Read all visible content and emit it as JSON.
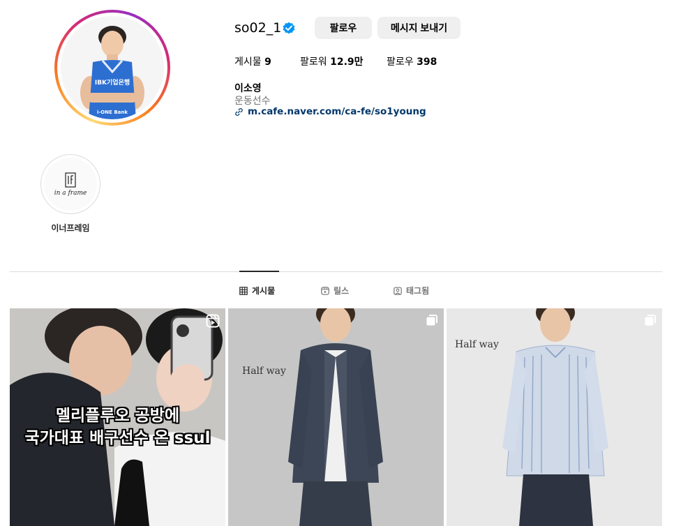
{
  "profile": {
    "username": "so02_1",
    "follow_label": "팔로우",
    "message_label": "메시지 보내기",
    "stats": {
      "posts_label": "게시물",
      "posts_value": "9",
      "followers_label": "팔로워",
      "followers_value": "12.9만",
      "following_label": "팔로우",
      "following_value": "398"
    },
    "full_name": "이소영",
    "category": "운동선수",
    "link": "m.cafe.naver.com/ca-fe/so1young",
    "avatar_jersey_text": "IBK기업은행",
    "avatar_jersey_text2": "i-ONE Bank"
  },
  "highlights": [
    {
      "label": "이너프레임",
      "logo_text": "in a frame"
    }
  ],
  "tabs": [
    {
      "label": "게시물",
      "icon": "grid-icon",
      "active": true
    },
    {
      "label": "릴스",
      "icon": "reels-icon",
      "active": false
    },
    {
      "label": "태그됨",
      "icon": "tagged-icon",
      "active": false
    }
  ],
  "posts": [
    {
      "type": "reel",
      "caption_line1": "멜리플루오 공방에",
      "caption_line2": "국가대표 배구선수 온 ssul"
    },
    {
      "type": "carousel",
      "brand": "Half way"
    },
    {
      "type": "carousel",
      "brand": "Half way"
    }
  ],
  "colors": {
    "verified": "#0095f6",
    "link": "#00376b",
    "button_bg": "#efefef"
  }
}
